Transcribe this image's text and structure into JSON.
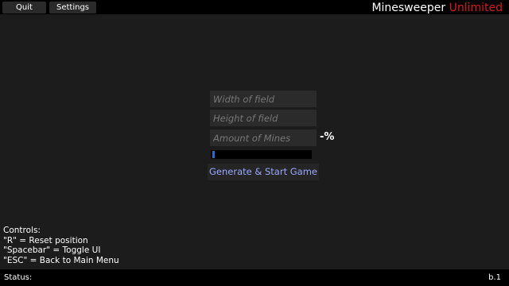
{
  "topbar": {
    "quit_label": "Quit",
    "settings_label": "Settings",
    "title_main": "Minesweeper",
    "title_accent": "Unlimited",
    "accent_color": "#e01616"
  },
  "form": {
    "width_placeholder": "Width of field",
    "height_placeholder": "Height of field",
    "mines_placeholder": "Amount of Mines",
    "mines_percent": "-%",
    "progress": 0.02,
    "progress_color": "#1a6fd8",
    "generate_label": "Generate & Start Game"
  },
  "controls": {
    "heading": "Controls:",
    "lines": [
      "\"R\" = Reset position",
      "\"Spacebar\" = Toggle UI",
      "\"ESC\" = Back to Main Menu"
    ]
  },
  "statusbar": {
    "label": "Status:",
    "value": "",
    "build": "b.1"
  }
}
